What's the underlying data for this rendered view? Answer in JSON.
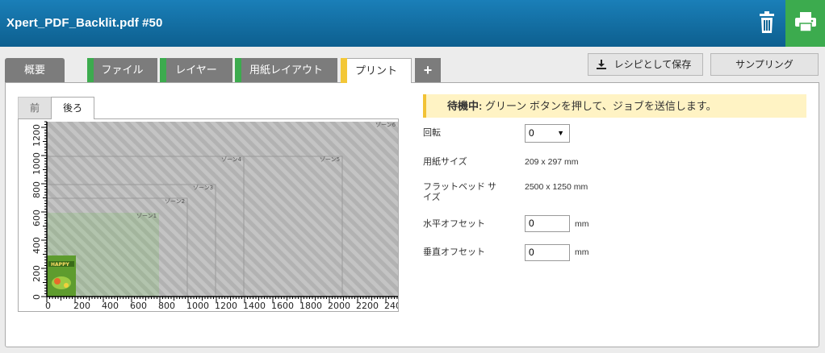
{
  "header": {
    "title": "Xpert_PDF_Backlit.pdf #50"
  },
  "tabs": [
    {
      "label": "概要"
    },
    {
      "label": "ファイル"
    },
    {
      "label": "レイヤー"
    },
    {
      "label": "用紙レイアウト"
    },
    {
      "label": "プリント"
    },
    {
      "label": "+"
    }
  ],
  "toolbar": {
    "save_recipe_label": "レシピとして保存",
    "sampling_label": "サンプリング"
  },
  "subtabs": {
    "front": "前",
    "back": "後ろ"
  },
  "preview": {
    "y_ticks": [
      "0",
      "200",
      "400",
      "600",
      "800",
      "1000",
      "1200"
    ],
    "x_ticks": [
      "0",
      "200",
      "400",
      "600",
      "800",
      "1000",
      "1200",
      "1400",
      "1600",
      "1800",
      "2000",
      "2200",
      "240"
    ],
    "zones": {
      "z1": "ゾーン1",
      "z2": "ゾーン2",
      "z3": "ゾーン3",
      "z4": "ゾーン4",
      "z5": "ゾーン5",
      "z6": "ゾーン6"
    },
    "thumb_text": "HAPPY"
  },
  "status": {
    "bold": "待機中:",
    "text": " グリーン ボタンを押して、ジョブを送信します。"
  },
  "fields": {
    "rotation": {
      "label": "回転",
      "value": "0"
    },
    "paper_size": {
      "label": "用紙サイズ",
      "value": "209 x 297 mm"
    },
    "flatbed_size": {
      "label": "フラットベッド サイズ",
      "value": "2500 x 1250 mm"
    },
    "h_offset": {
      "label": "水平オフセット",
      "value": "0",
      "unit": "mm"
    },
    "v_offset": {
      "label": "垂直オフセット",
      "value": "0",
      "unit": "mm"
    }
  },
  "colors": {
    "header": "#0d5f8f",
    "green": "#3cab4e",
    "yellow": "#f3c737",
    "tab_gray": "#7c7c7c"
  }
}
